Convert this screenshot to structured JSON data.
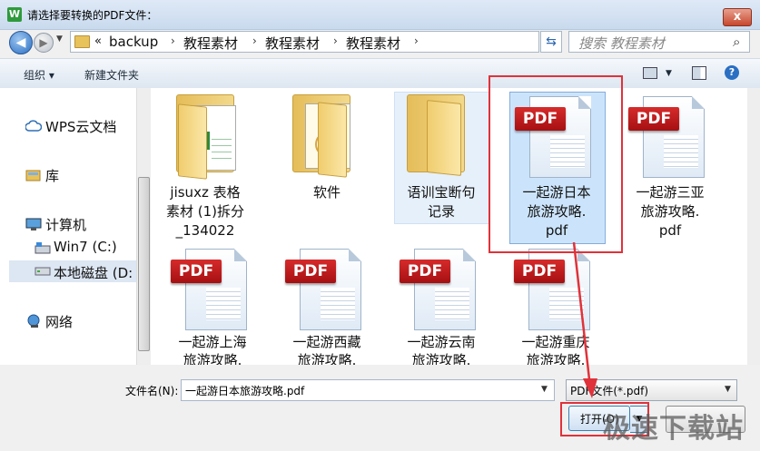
{
  "window": {
    "title": "请选择要转换的PDF文件：",
    "app_icon": "wps-app-icon",
    "close_label": "x"
  },
  "address_bar": {
    "overflow": "«",
    "crumbs": [
      "backup",
      "教程素材",
      "教程素材",
      "教程素材"
    ],
    "separator": "›"
  },
  "search": {
    "placeholder": "搜索 教程素材"
  },
  "toolbar": {
    "organize_label": "组织 ▾",
    "new_folder_label": "新建文件夹"
  },
  "nav_pane": {
    "items": [
      {
        "label": "WPS云文档",
        "icon": "cloud-icon"
      },
      {
        "label": "库",
        "icon": "library-icon"
      },
      {
        "label": "计算机",
        "icon": "computer-icon"
      },
      {
        "label": "Win7 (C:)",
        "icon": "drive-icon"
      },
      {
        "label": "本地磁盘 (D:",
        "icon": "disk-icon",
        "selected": true
      },
      {
        "label": "网络",
        "icon": "network-icon"
      }
    ]
  },
  "files": [
    {
      "label": [
        "jisuxz 表格",
        "素材 (1)拆分",
        "_134022"
      ],
      "type": "folder-excel"
    },
    {
      "label": [
        "软件"
      ],
      "type": "folder-software"
    },
    {
      "label": [
        "语训宝断句",
        "记录"
      ],
      "type": "folder"
    },
    {
      "label": [
        "一起游日本",
        "旅游攻略.",
        "pdf"
      ],
      "type": "pdf",
      "selected": true
    },
    {
      "label": [
        "一起游三亚",
        "旅游攻略.",
        "pdf"
      ],
      "type": "pdf"
    },
    {
      "label": [
        "一起游上海",
        "旅游攻略."
      ],
      "type": "pdf"
    },
    {
      "label": [
        "一起游西藏",
        "旅游攻略."
      ],
      "type": "pdf"
    },
    {
      "label": [
        "一起游云南",
        "旅游攻略."
      ],
      "type": "pdf"
    },
    {
      "label": [
        "一起游重庆",
        "旅游攻略."
      ],
      "type": "pdf"
    }
  ],
  "pdf_badge": "PDF",
  "bottom": {
    "filename_label": "文件名(N):",
    "filename_value": "一起游日本旅游攻略.pdf",
    "filetype_value": "PDF文件(*.pdf)",
    "open_label": "打开(O)",
    "watermark": "极速下载站"
  },
  "colors": {
    "highlight_red": "#e0323a",
    "selection_blue": "#cce4fb",
    "pdf_red": "#c41a1d"
  }
}
